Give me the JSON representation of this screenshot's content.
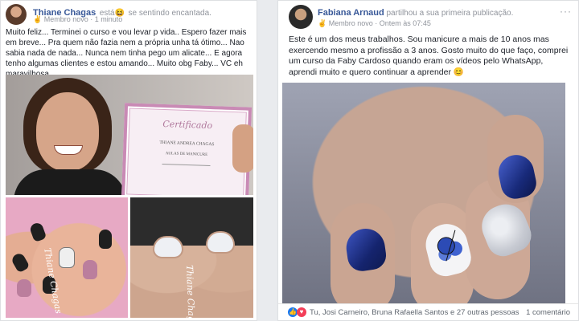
{
  "post1": {
    "author": "Thiane Chagas",
    "action": "está",
    "feeling_emoji": "😆",
    "feeling": "se sentindo encantada.",
    "badge": "Membro novo",
    "time": "1 minuto",
    "text": "Muito feliz... Terminei o curso e vou levar p vida.. Espero fazer mais em breve... Pra quem não fazia nem a própria unha tá ótimo... Nao sabia nada de nada... Nunca nem tinha pego um alicate... E agora tenho algumas clientes e estou amando... Muito obg Faby... VC eh maravilhosa",
    "certificate": {
      "title": "Certificado",
      "name": "THIANE ANDREA CHAGAS",
      "course": "AULAS DE MANICURE"
    },
    "watermark1": "Thiane Chagas",
    "watermark2": "Thiane Chagas"
  },
  "post2": {
    "author": "Fabiana Arnaud",
    "action": "partilhou a sua primeira publicação.",
    "badge": "Membro novo",
    "time": "Ontem às 07:45",
    "text": "Este é um dos meus trabalhos. Sou manicure a mais de 10 anos mas exercendo mesmo a profissão a 3 anos. Gosto muito do que faço, comprei um curso da Faby Cardoso quando eram os vídeos pelo WhatsApp, aprendi muito e quero continuar a aprender 😊",
    "reactions": "Tu, Josi Carneiro, Bruna Rafaella Santos e 27 outras pessoas",
    "comments": "1 comentário"
  },
  "icons": {
    "more": "more-options-icon",
    "like": "like-reaction-icon",
    "love": "love-reaction-icon",
    "members": "members-icon",
    "globe": "globe-icon"
  },
  "colors": {
    "link": "#385898",
    "like": "#1877f2",
    "love": "#f33e58",
    "nail_blue": "#1b2f86",
    "nail_black": "#202020",
    "nail_pink": "#b3809a"
  }
}
